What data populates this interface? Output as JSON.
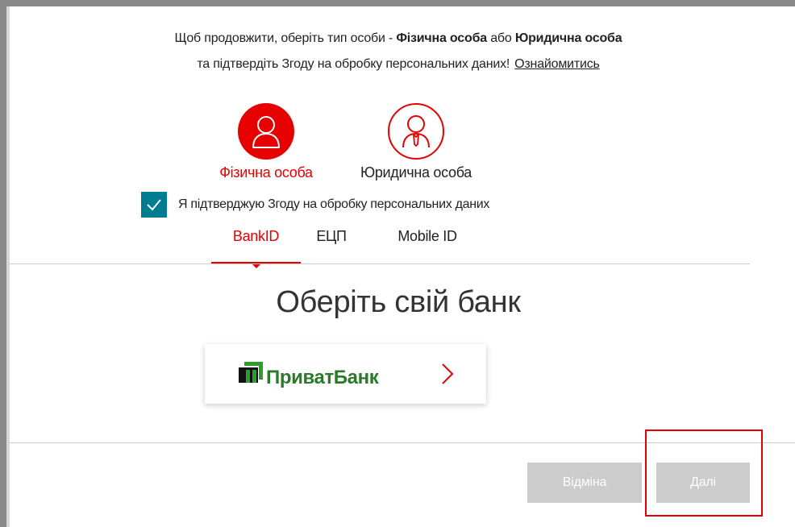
{
  "intro": {
    "line1_prefix": "Щоб продовжити, оберіть тип особи - ",
    "natural_bold": "Фізична особа",
    "line1_middle": " або ",
    "legal_bold": "Юридична особа",
    "line2": "та підтвердіть Згоду на обробку персональних даних!",
    "link": "Ознайомитись"
  },
  "person_types": {
    "natural": {
      "label": "Фізична особа",
      "icon": "person-icon",
      "selected": true
    },
    "legal": {
      "label": "Юридична особа",
      "icon": "person-tie-icon",
      "selected": false
    }
  },
  "consent": {
    "label": "Я підтверджую Згоду на обробку персональних даних",
    "checked": true
  },
  "tabs": [
    {
      "label": "BankID",
      "active": true
    },
    {
      "label": "ЕЦП",
      "active": false
    },
    {
      "label": "Mobile ID",
      "active": false
    }
  ],
  "bank_section": {
    "heading": "Оберіть свій банк",
    "bank_name": "ПриватБанк"
  },
  "buttons": {
    "cancel": "Відміна",
    "next": "Далі"
  },
  "colors": {
    "accent": "#e60000",
    "checkbox": "#007c92",
    "bank_green": "#2a7a2a",
    "button_disabled": "#cccccc"
  }
}
